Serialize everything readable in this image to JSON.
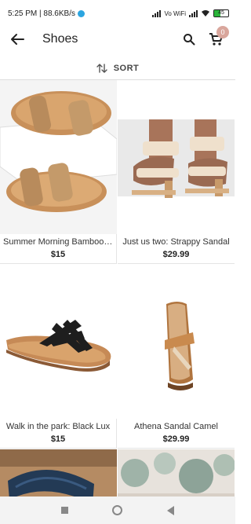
{
  "status_bar": {
    "time_net": "5:25 PM | 88.6KB/s",
    "network": "Vo WiFi",
    "battery": "45"
  },
  "header": {
    "title": "Shoes",
    "cart_count": "0"
  },
  "sort": {
    "label": "SORT"
  },
  "products": [
    {
      "name": "Summer Morning Bamboo Sandal",
      "price": "$15"
    },
    {
      "name": "Just us two: Strappy Sandal",
      "price": "$29.99"
    },
    {
      "name": "Walk in the park: Black Lux",
      "price": "$15"
    },
    {
      "name": "Athena Sandal Camel",
      "price": "$29.99"
    }
  ],
  "colors": {
    "accent": "#d9a69c",
    "telegram": "#2ca5e0",
    "battery": "#2ab53a"
  },
  "icons": [
    "back-arrow-icon",
    "search-icon",
    "cart-icon",
    "sort-arrows-icon"
  ]
}
